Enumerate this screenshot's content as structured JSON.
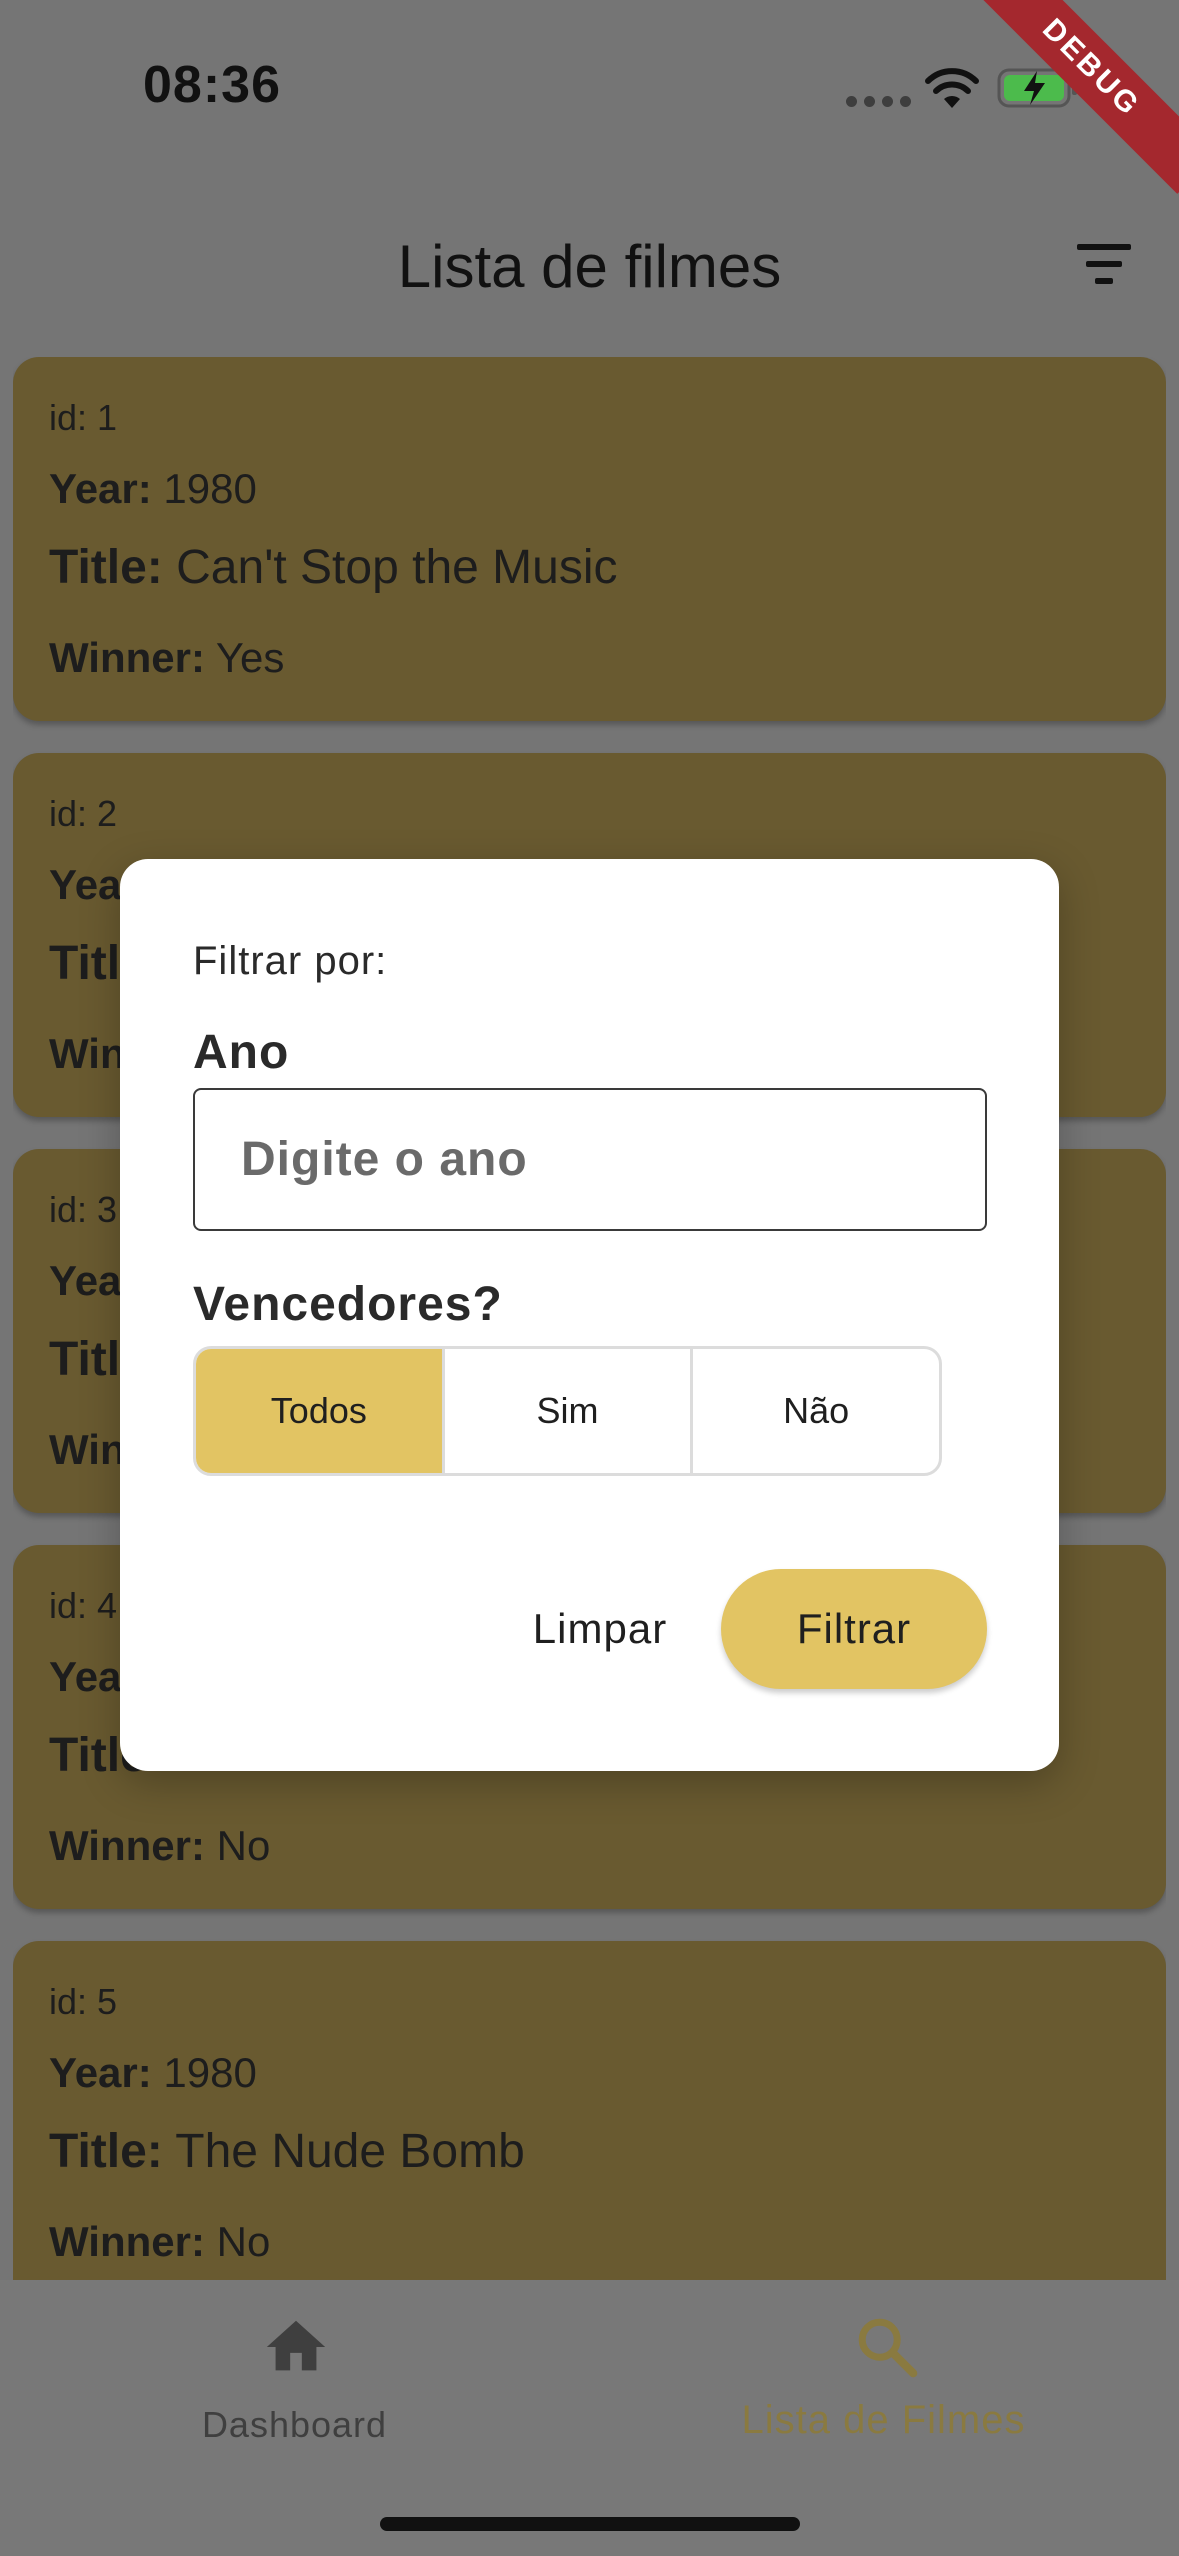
{
  "status_bar": {
    "time": "08:36"
  },
  "debug_banner": "DEBUG",
  "app_bar": {
    "title": "Lista de filmes"
  },
  "movie_list": {
    "labels": {
      "year": "Year:",
      "title": "Title:",
      "winner": "Winner:"
    },
    "items": [
      {
        "id": "id: 1",
        "year": "1980",
        "title": "Can't Stop the Music",
        "winner": "Yes"
      },
      {
        "id": "id: 2",
        "year": "",
        "title": "",
        "winner": ""
      },
      {
        "id": "id: 3",
        "year": "",
        "title": "",
        "winner": ""
      },
      {
        "id": "id: 4",
        "year": "",
        "title": "",
        "winner": "No"
      },
      {
        "id": "id: 5",
        "year": "1980",
        "title": "The Nude Bomb",
        "winner": "No"
      }
    ]
  },
  "filter_dialog": {
    "heading": "Filtrar por:",
    "year_label": "Ano",
    "year_value": "",
    "year_placeholder": "Digite o ano",
    "winners_label": "Vencedores?",
    "winner_options": [
      "Todos",
      "Sim",
      "Não"
    ],
    "selected_option": "Todos",
    "clear_label": "Limpar",
    "filter_label": "Filtrar"
  },
  "bottom_nav": {
    "items": [
      {
        "label": "Dashboard",
        "icon": "home-icon",
        "active": false
      },
      {
        "label": "Lista de Filmes",
        "icon": "search-icon",
        "active": true
      }
    ]
  },
  "colors": {
    "accent": "#e2c463",
    "card_dimmed": "#695a30",
    "nav_active_dimmed": "#8a7a40",
    "nav_inactive": "#3f3f3f",
    "scrim_background": "#757575",
    "debug_banner": "#a4282e"
  }
}
